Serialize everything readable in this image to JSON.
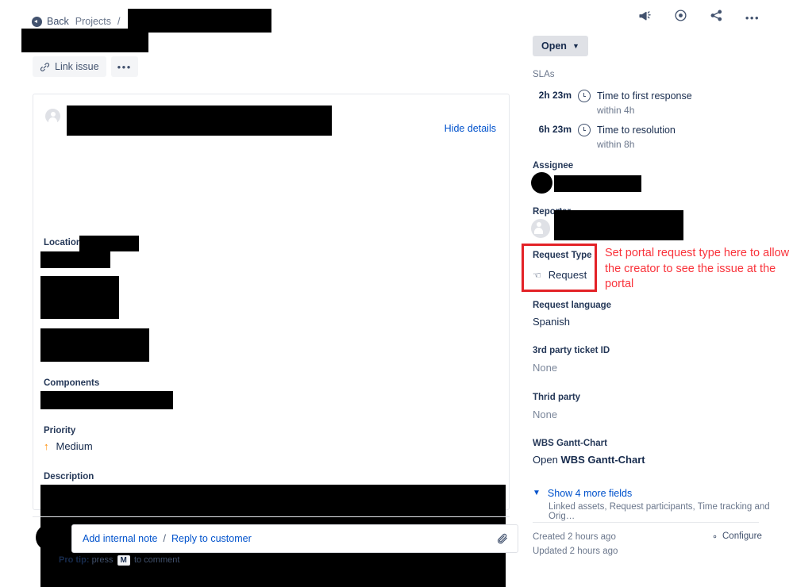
{
  "breadcrumb": {
    "back_label": "Back",
    "projects_label": "Projects",
    "separator": "/"
  },
  "actions": {
    "link_issue_label": "Link issue",
    "more_label": "•••"
  },
  "detail_card": {
    "hide_details_label": "Hide details",
    "fields": {
      "location_label": "Location",
      "components_label": "Components",
      "priority_label": "Priority",
      "priority_value": "Medium",
      "description_label": "Description"
    }
  },
  "comment": {
    "add_internal_note_label": "Add internal note",
    "separator": "/",
    "reply_to_customer_label": "Reply to customer",
    "pro_tip_prefix": "Pro tip:",
    "pro_tip_press": "press",
    "pro_tip_key": "M",
    "pro_tip_suffix": "to comment"
  },
  "sidebar": {
    "status_label": "Open",
    "slas_label": "SLAs",
    "slas": [
      {
        "time": "2h 23m",
        "title": "Time to first response",
        "target": "within 4h"
      },
      {
        "time": "6h 23m",
        "title": "Time to resolution",
        "target": "within 8h"
      }
    ],
    "assignee_label": "Assignee",
    "reporter_label": "Reporter",
    "request_type_label": "Request Type",
    "request_type_value": "Request",
    "request_language_label": "Request language",
    "request_language_value": "Spanish",
    "third_party_ticket_label": "3rd party ticket ID",
    "third_party_ticket_value": "None",
    "thrid_party_label": "Thrid party",
    "thrid_party_value": "None",
    "wbs_label": "WBS Gantt-Chart",
    "wbs_value_open": "Open",
    "wbs_value_link": "WBS Gantt-Chart",
    "show_more_label": "Show 4 more fields",
    "show_more_sub": "Linked assets, Request participants, Time tracking and Orig…",
    "created_text": "Created 2 hours ago",
    "updated_text": "Updated 2 hours ago",
    "configure_label": "Configure"
  },
  "annotation": {
    "text": "Set portal request type here to allow the creator to see the issue at the portal",
    "color": "#f9333b",
    "box_color": "#e32227"
  }
}
